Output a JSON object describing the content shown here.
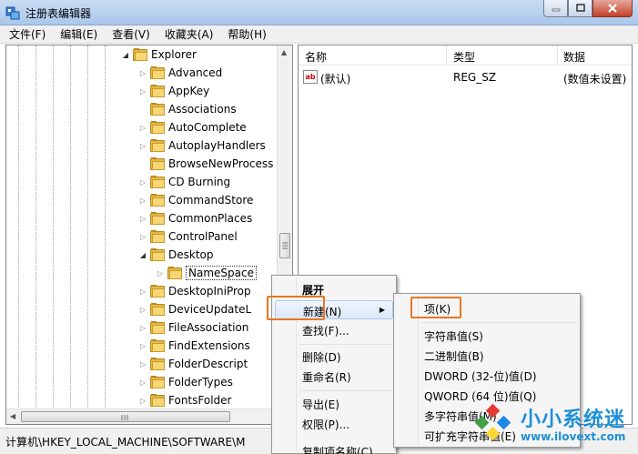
{
  "window": {
    "title": "注册表编辑器"
  },
  "menubar": [
    {
      "label": "文件(F)"
    },
    {
      "label": "编辑(E)"
    },
    {
      "label": "查看(V)"
    },
    {
      "label": "收藏夹(A)"
    },
    {
      "label": "帮助(H)"
    }
  ],
  "tree": {
    "nodes": [
      {
        "label": "Explorer",
        "expander": "expanded"
      },
      {
        "label": "Advanced",
        "expander": "collapsed"
      },
      {
        "label": "AppKey",
        "expander": "collapsed"
      },
      {
        "label": "Associations",
        "expander": "none"
      },
      {
        "label": "AutoComplete",
        "expander": "collapsed"
      },
      {
        "label": "AutoplayHandlers",
        "expander": "collapsed"
      },
      {
        "label": "BrowseNewProcess",
        "expander": "none"
      },
      {
        "label": "CD Burning",
        "expander": "collapsed"
      },
      {
        "label": "CommandStore",
        "expander": "collapsed"
      },
      {
        "label": "CommonPlaces",
        "expander": "collapsed"
      },
      {
        "label": "ControlPanel",
        "expander": "collapsed"
      },
      {
        "label": "Desktop",
        "expander": "expanded"
      },
      {
        "label": "NameSpace",
        "expander": "collapsed",
        "selected": true
      },
      {
        "label": "DesktopIniProp",
        "expander": "collapsed"
      },
      {
        "label": "DeviceUpdateL",
        "expander": "collapsed"
      },
      {
        "label": "FileAssociation",
        "expander": "collapsed"
      },
      {
        "label": "FindExtensions",
        "expander": "collapsed"
      },
      {
        "label": "FolderDescript",
        "expander": "collapsed"
      },
      {
        "label": "FolderTypes",
        "expander": "collapsed"
      },
      {
        "label": "FontsFolder",
        "expander": "collapsed"
      }
    ]
  },
  "values": {
    "columns": [
      "名称",
      "类型",
      "数据"
    ],
    "rows": [
      {
        "name": "(默认)",
        "type": "REG_SZ",
        "data": "(数值未设置)",
        "icon": "ab-icon"
      }
    ]
  },
  "context_menu": {
    "items": [
      {
        "label": "展开",
        "bold": true
      },
      {
        "label": "新建(N)",
        "submenu": true,
        "hover": true
      },
      {
        "label": "查找(F)..."
      },
      {
        "label": "删除(D)"
      },
      {
        "label": "重命名(R)"
      },
      {
        "label": "导出(E)"
      },
      {
        "label": "权限(P)..."
      },
      {
        "label": "复制项名称(C)"
      }
    ]
  },
  "submenu": {
    "items": [
      {
        "label": "项(K)"
      },
      {
        "label": "字符串值(S)"
      },
      {
        "label": "二进制值(B)"
      },
      {
        "label": "DWORD (32-位)值(D)"
      },
      {
        "label": "QWORD (64 位)值(Q)"
      },
      {
        "label": "多字符串值(M)"
      },
      {
        "label": "可扩充字符串值(E)"
      }
    ]
  },
  "statusbar": {
    "path": "计算机\\HKEY_LOCAL_MACHINE\\SOFTWARE\\M"
  },
  "watermark": {
    "brand": "小小系统迷",
    "url": "www.ilovext.com"
  },
  "colors": {
    "highlight_outline": "#e87722",
    "watermark": "#1d8fd8"
  }
}
